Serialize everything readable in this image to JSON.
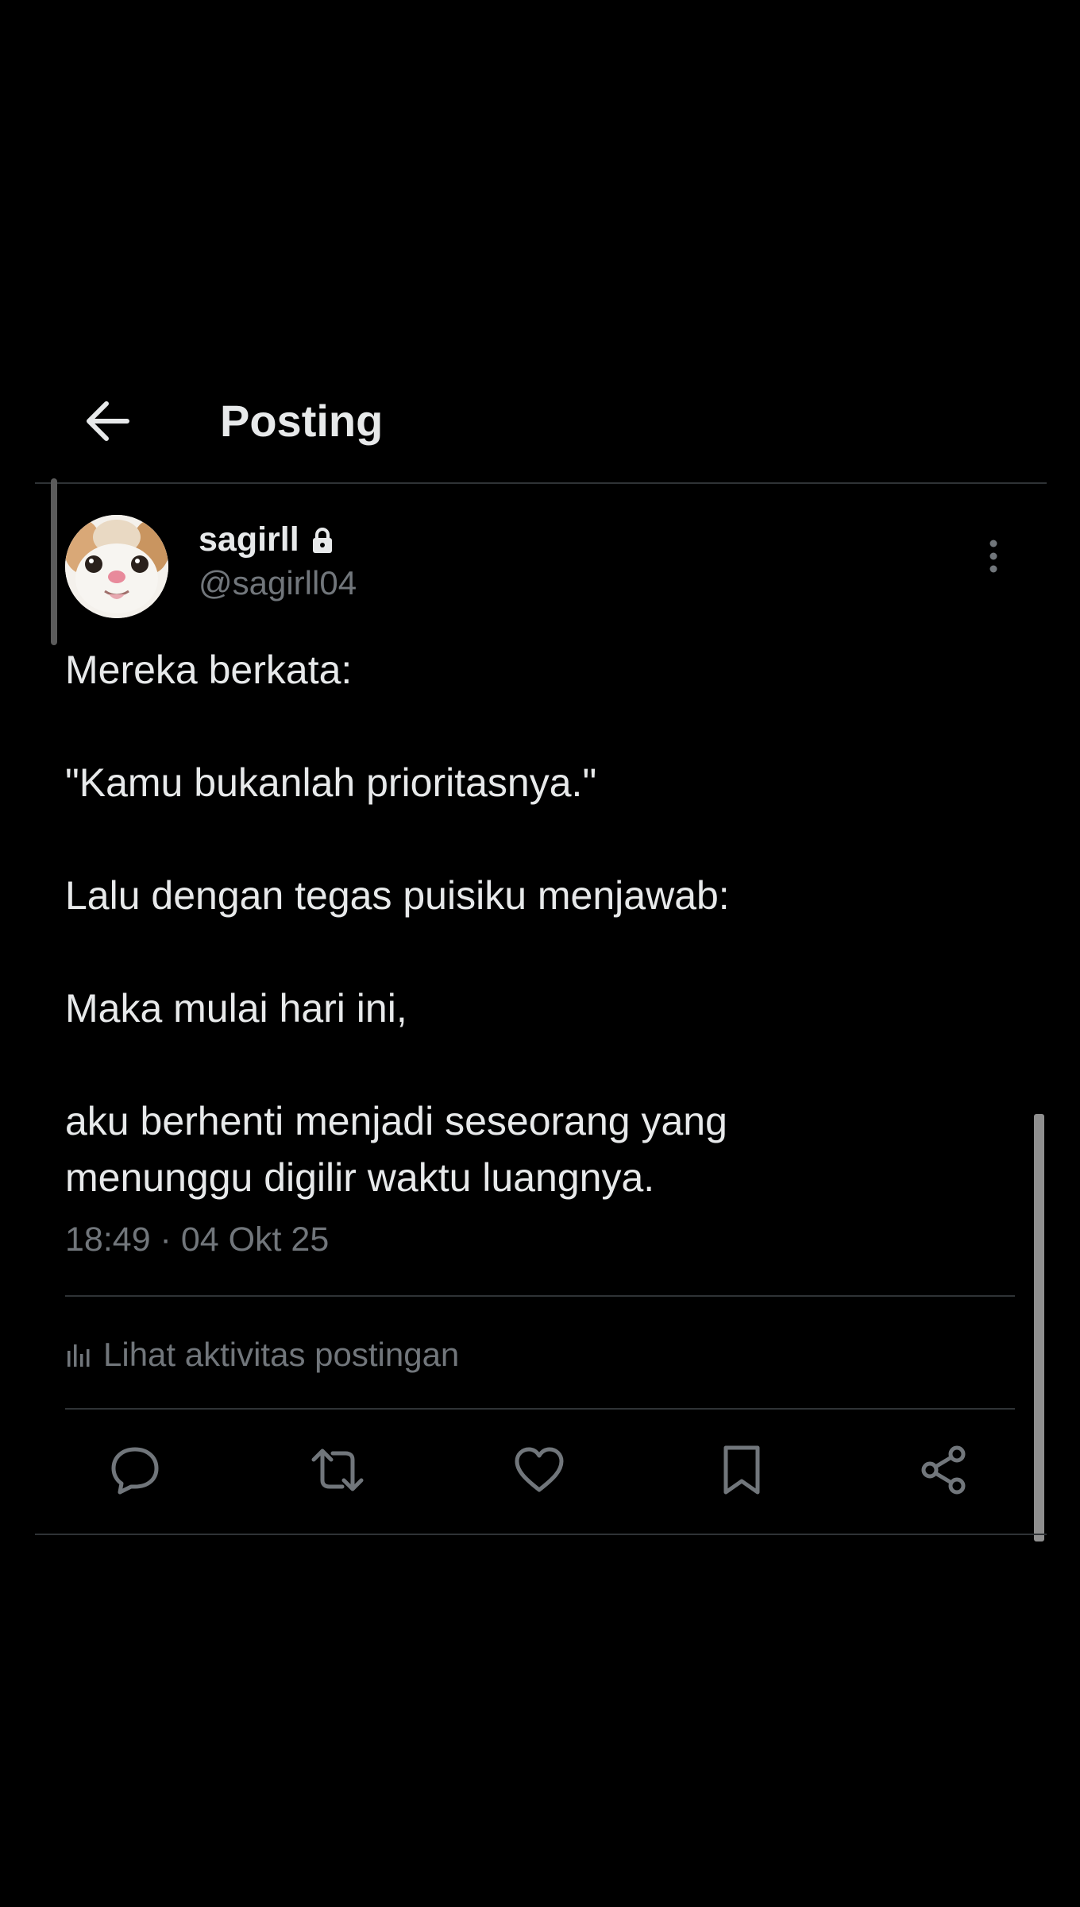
{
  "header": {
    "title": "Posting",
    "back_icon": "arrow-left-icon"
  },
  "post": {
    "author": {
      "name": "sagirll",
      "handle": "@sagirll04",
      "protected_icon": "lock-icon",
      "avatar": "cat-face-avatar"
    },
    "more_icon": "more-vertical-icon",
    "lines": [
      "Mereka berkata:",
      "\"Kamu bukanlah prioritasnya.\"",
      "Lalu dengan tegas puisiku menjawab:",
      "Maka mulai hari ini,",
      "aku berhenti menjadi seseorang yang",
      "menunggu digilir waktu luangnya."
    ],
    "timestamp": "18:49 · 04 Okt 25",
    "activity_label": "Lihat aktivitas postingan",
    "activity_icon": "analytics-bar-icon",
    "actions": [
      "reply-icon",
      "repost-icon",
      "like-icon",
      "bookmark-icon",
      "share-icon"
    ]
  },
  "colors": {
    "background": "#000000",
    "primary_text": "#e7e9ea",
    "secondary_text": "#71767b",
    "divider": "#2f3336"
  }
}
